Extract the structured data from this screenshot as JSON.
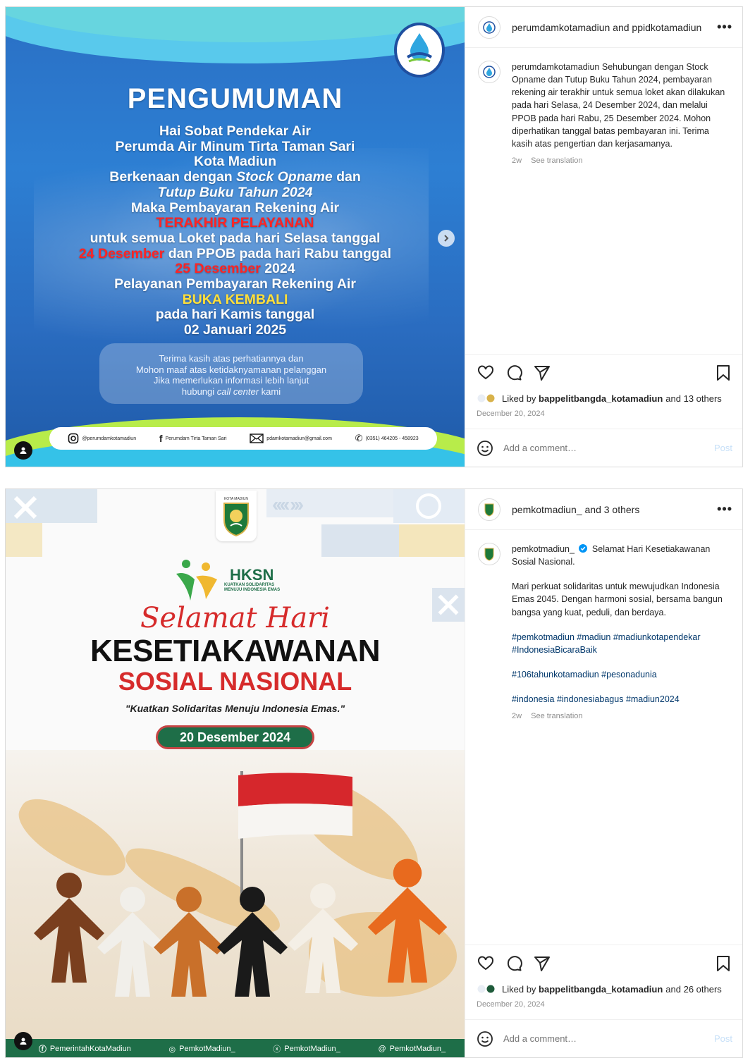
{
  "post1": {
    "header": {
      "accounts": "perumdamkotamadiun and ppidkotamadiun",
      "more": "•••"
    },
    "caption": {
      "username": "perumdamkotamadiun",
      "text": "Sehubungan dengan Stock Opname dan Tutup Buku Tahun 2024, pembayaran rekening air terakhir untuk semua loket akan dilakukan pada hari Selasa, 24 Desember 2024, dan melalui PPOB pada hari Rabu, 25 Desember 2024. Mohon diperhatikan tanggal batas pembayaran ini. Terima kasih atas pengertian dan kerjasamanya.",
      "age": "2w",
      "translate": "See translation"
    },
    "likes": {
      "prefix": "Liked by ",
      "user": "bappelitbangda_kotamadiun",
      "suffix": " and 13 others"
    },
    "date": "December 20, 2024",
    "comment_placeholder": "Add a comment…",
    "post_label": "Post",
    "image": {
      "title": "PENGUMUMAN",
      "lines": {
        "l1": "Hai Sobat Pendekar Air",
        "l2": "Perumda Air Minum Tirta Taman Sari",
        "l3": "Kota Madiun",
        "l4a": "Berkenaan dengan ",
        "l4b": "Stock Opname",
        "l4c": " dan",
        "l5": "Tutup Buku Tahun 2024",
        "l6": "Maka Pembayaran Rekening Air",
        "l7": "TERAKHIR PELAYANAN",
        "l8": "untuk semua Loket pada hari Selasa tanggal",
        "l9a": "24 Desember",
        "l9b": " dan PPOB pada hari Rabu tanggal",
        "l10a": "25 Desember",
        "l10b": " 2024",
        "l11": "Pelayanan Pembayaran Rekening Air",
        "l12": "BUKA KEMBALI",
        "l13": "pada hari Kamis tanggal",
        "l14": "02 Januari 2025"
      },
      "box": {
        "b1": "Terima kasih atas perhatiannya dan",
        "b2": "Mohon maaf atas ketidaknyamanan pelanggan",
        "b3": "Jika memerlukan informasi lebih lanjut",
        "b4a": "hubungi ",
        "b4b": "call center",
        "b4c": " kami"
      },
      "contacts": {
        "instagram": "@perumdamkotamadiun",
        "facebook": "Perumdam Tirta Taman Sari",
        "email": "pdamkotamadiun@gmail.com",
        "phone": "(0351) 464205 - 458923"
      }
    }
  },
  "post2": {
    "header": {
      "accounts": "pemkotmadiun_ and 3 others",
      "more": "•••"
    },
    "caption": {
      "username": "pemkotmadiun_",
      "line1": "Selamat Hari Kesetiakawanan Sosial Nasional.",
      "para2": "Mari perkuat solidaritas untuk mewujudkan Indonesia Emas 2045. Dengan harmoni sosial, bersama bangun bangsa yang kuat, peduli, dan berdaya.",
      "tags1": "#pemkotmadiun #madiun #madiunkotapendekar #IndonesiaBicaraBaik",
      "tags2": "#106tahunkotamadiun #pesonadunia",
      "tags3": "#indonesia #indonesiabagus #madiun2024",
      "age": "2w",
      "translate": "See translation"
    },
    "likes": {
      "prefix": "Liked by ",
      "user": "bappelitbangda_kotamadiun",
      "suffix": " and 26 others"
    },
    "date": "December 20, 2024",
    "comment_placeholder": "Add a comment…",
    "post_label": "Post",
    "image": {
      "crest_label": "KOTA MADIUN",
      "hksn": "HKSN",
      "hksn_sub1": "KUATKAN SOLIDARITAS",
      "hksn_sub2": "MENUJU INDONESIA EMAS",
      "script": "Selamat Hari",
      "big1": "KESETIAKAWANAN",
      "big2": "SOSIAL NASIONAL",
      "quote": "\"Kuatkan Solidaritas Menuju Indonesia Emas.\"",
      "date": "20 Desember 2024",
      "footer": {
        "facebook": "PemerintahKotaMadiun",
        "instagram": "PemkotMadiun_",
        "x": "PemkotMadiun_",
        "threads": "PemkotMadiun_"
      }
    }
  },
  "colors": {
    "link": "#00376b",
    "muted": "#8e8e8e",
    "red": "#d62b2b",
    "green": "#1e6e48",
    "blue": "#2a6fc4"
  }
}
